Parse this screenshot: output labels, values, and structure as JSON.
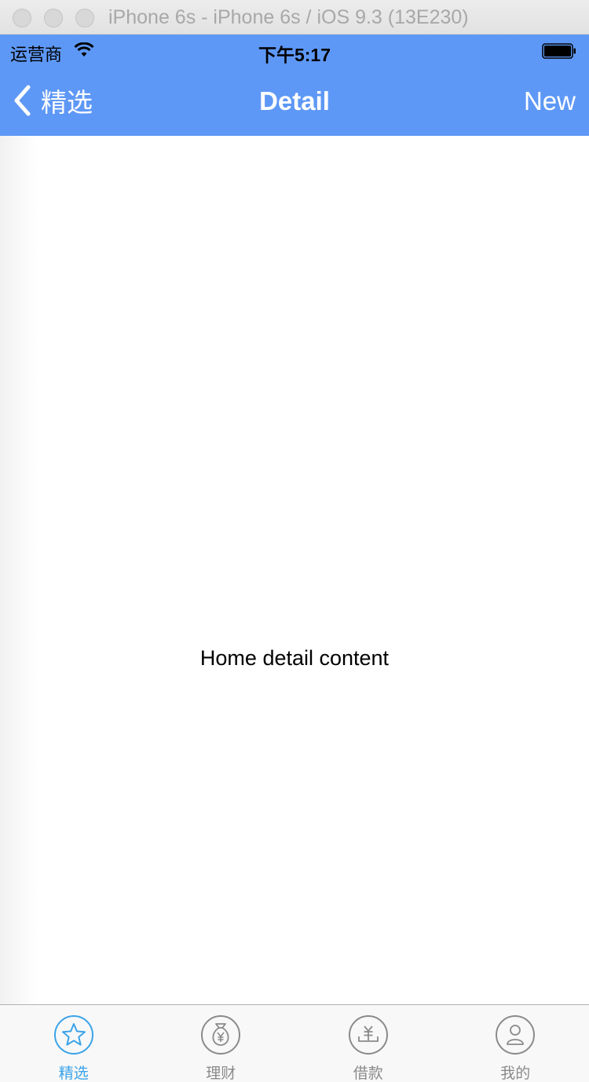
{
  "window": {
    "title": "iPhone 6s - iPhone 6s / iOS 9.3 (13E230)"
  },
  "status_bar": {
    "carrier": "运营商",
    "time": "下午5:17"
  },
  "nav_bar": {
    "back_label": "精选",
    "title": "Detail",
    "right_button": "New",
    "color": "#5e98f6"
  },
  "content": {
    "text": "Home detail content"
  },
  "tab_bar": {
    "active_color": "#3aa3e8",
    "items": [
      {
        "label": "精选",
        "icon": "star-icon",
        "active": true
      },
      {
        "label": "理财",
        "icon": "money-bag-icon",
        "active": false
      },
      {
        "label": "借款",
        "icon": "loan-icon",
        "active": false
      },
      {
        "label": "我的",
        "icon": "user-icon",
        "active": false
      }
    ]
  }
}
